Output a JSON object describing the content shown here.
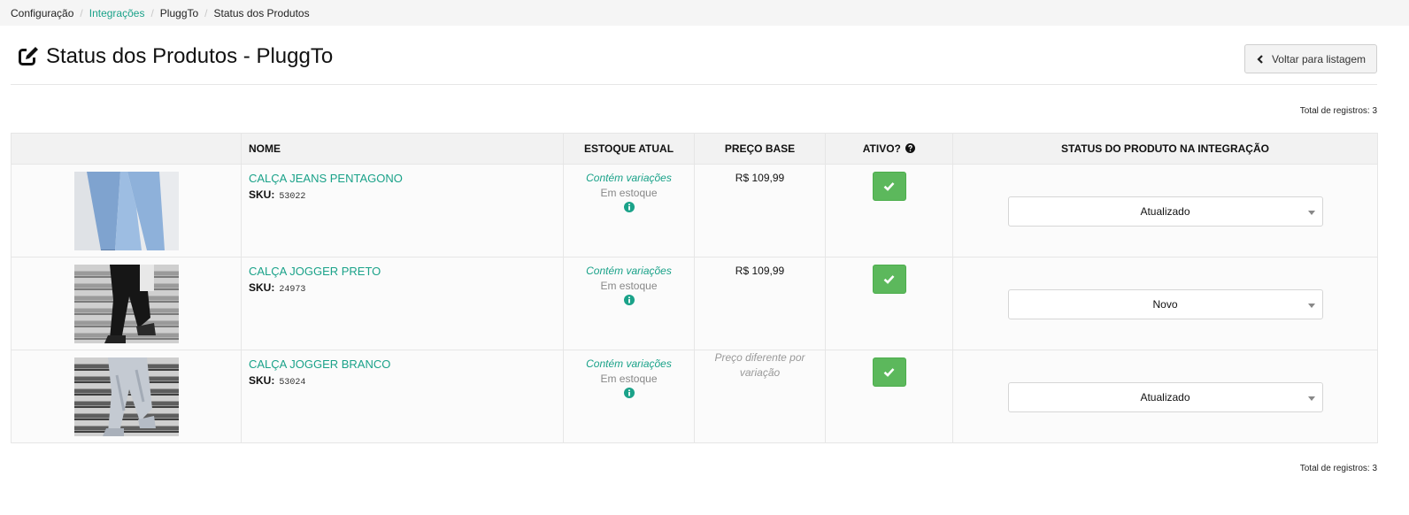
{
  "breadcrumb": {
    "items": [
      "Configuração",
      "Integrações",
      "PluggTo",
      "Status dos Produtos"
    ],
    "separator": "/"
  },
  "header": {
    "title": "Status dos Produtos - PluggTo",
    "title_icon": "edit-icon",
    "back_label": "Voltar para listagem",
    "back_icon": "chevron-left-icon"
  },
  "totals": {
    "top": "Total de registros: 3",
    "bottom": "Total de registros: 3"
  },
  "table": {
    "columns": [
      "",
      "NOME",
      "ESTOQUE ATUAL",
      "PREÇO BASE",
      "ATIVO?",
      "STATUS DO PRODUTO NA INTEGRAÇÃO"
    ],
    "sku_label": "SKU:",
    "rows": [
      {
        "image": "product-photo-jeans",
        "name": "CALÇA JEANS PENTAGONO",
        "sku": "53022",
        "stock_variations": "Contém variações",
        "stock_status": "Em estoque",
        "price": "R$ 109,99",
        "active": true,
        "status": "Atualizado"
      },
      {
        "image": "product-photo-jogger-black",
        "name": "CALÇA JOGGER PRETO",
        "sku": "24973",
        "stock_variations": "Contém variações",
        "stock_status": "Em estoque",
        "price": "R$ 109,99",
        "active": true,
        "status": "Novo"
      },
      {
        "image": "product-photo-jogger-white",
        "name": "CALÇA JOGGER BRANCO",
        "sku": "53024",
        "stock_variations": "Contém variações",
        "stock_status": "Em estoque",
        "price": "Preço diferente por variação",
        "active": true,
        "status": "Atualizado"
      }
    ]
  },
  "colors": {
    "accent": "#1aa289",
    "active_green": "#5cb85c",
    "header_bg": "#f2f2f2",
    "breadcrumb_bg": "#f5f5f5"
  }
}
